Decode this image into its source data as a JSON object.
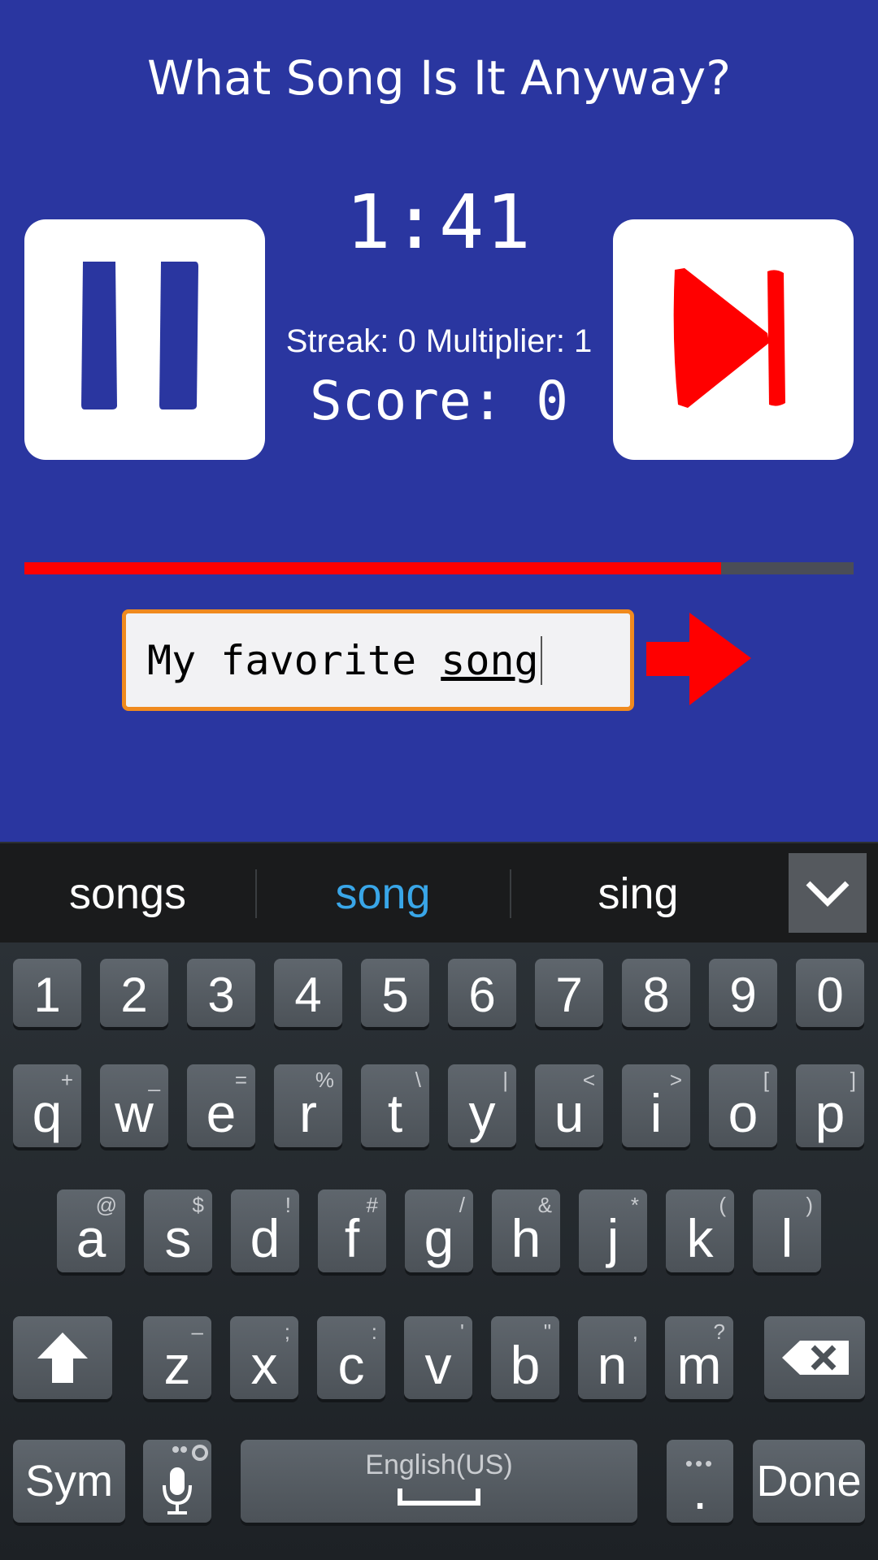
{
  "app": {
    "title": "What Song Is It Anyway?",
    "timer": "1:41",
    "streak": "Streak: 0",
    "multiplier": "Multiplier: 1",
    "score": "Score: 0",
    "progress_fraction": 0.84,
    "answer": {
      "prefix": "My favorite ",
      "composing": "song"
    }
  },
  "keyboard": {
    "suggestions": [
      "songs",
      "song",
      "sing"
    ],
    "number_row": [
      "1",
      "2",
      "3",
      "4",
      "5",
      "6",
      "7",
      "8",
      "9",
      "0"
    ],
    "row1": [
      {
        "k": "q",
        "s": "+"
      },
      {
        "k": "w",
        "s": "_"
      },
      {
        "k": "e",
        "s": "="
      },
      {
        "k": "r",
        "s": "%"
      },
      {
        "k": "t",
        "s": "\\"
      },
      {
        "k": "y",
        "s": "|"
      },
      {
        "k": "u",
        "s": "<"
      },
      {
        "k": "i",
        "s": ">"
      },
      {
        "k": "o",
        "s": "["
      },
      {
        "k": "p",
        "s": "]"
      }
    ],
    "row2": [
      {
        "k": "a",
        "s": "@"
      },
      {
        "k": "s",
        "s": "$"
      },
      {
        "k": "d",
        "s": "!"
      },
      {
        "k": "f",
        "s": "#"
      },
      {
        "k": "g",
        "s": "/"
      },
      {
        "k": "h",
        "s": "&"
      },
      {
        "k": "j",
        "s": "*"
      },
      {
        "k": "k",
        "s": "("
      },
      {
        "k": "l",
        "s": ")"
      }
    ],
    "row3": [
      {
        "k": "z",
        "s": "–"
      },
      {
        "k": "x",
        "s": ";"
      },
      {
        "k": "c",
        "s": ":"
      },
      {
        "k": "v",
        "s": "'"
      },
      {
        "k": "b",
        "s": "\""
      },
      {
        "k": "n",
        "s": ","
      },
      {
        "k": "m",
        "s": "?"
      }
    ],
    "sym_label": "Sym",
    "space_label": "English(US)",
    "period_label": ".",
    "done_label": "Done"
  },
  "colors": {
    "app_bg": "#2a36a0",
    "accent_red": "#ff0000",
    "field_border": "#f08a1e",
    "suggest_active": "#39a6e8"
  },
  "icons": [
    "pause-icon",
    "skip-next-icon",
    "submit-arrow-icon",
    "chevron-down-icon",
    "shift-icon",
    "backspace-icon",
    "mic-icon",
    "settings-icon",
    "space-icon"
  ]
}
